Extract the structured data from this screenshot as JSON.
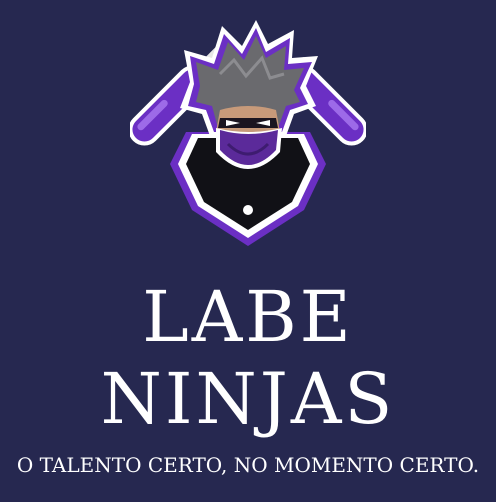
{
  "brand": {
    "logo_icon": "ninja-mascot-icon",
    "title_line1": "LABE",
    "title_line2": "NINJAS",
    "tagline": "O TALENTO CERTO, NO MOMENTO CERTO."
  },
  "colors": {
    "background": "#262850",
    "accent": "#6b2fc4",
    "text": "#ffffff"
  }
}
